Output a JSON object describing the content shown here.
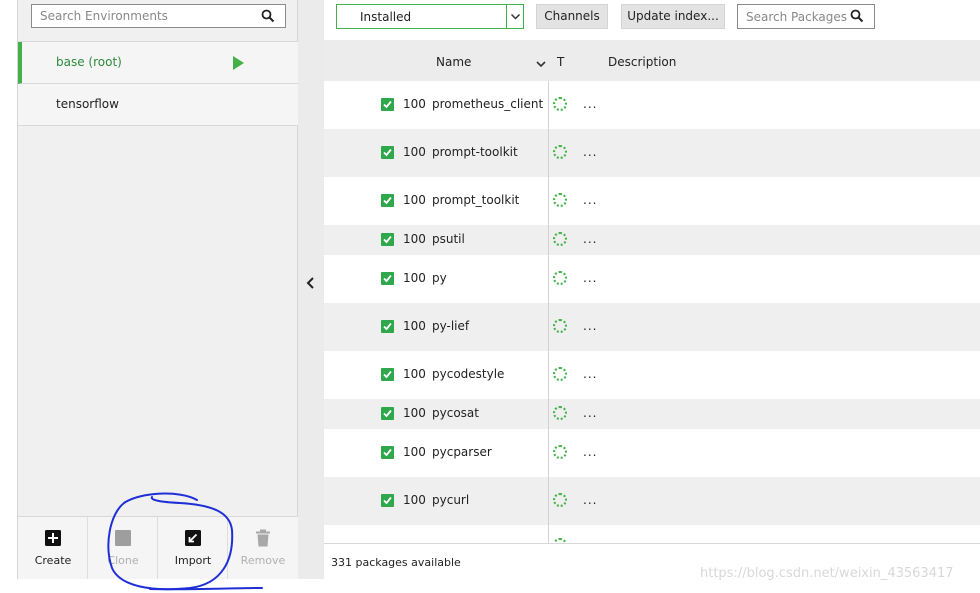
{
  "environments": {
    "search_placeholder": "Search Environments",
    "items": [
      {
        "label": "base (root)",
        "active": true
      },
      {
        "label": "tensorflow",
        "active": false
      }
    ],
    "actions": {
      "create": "Create",
      "clone": "Clone",
      "import": "Import",
      "remove": "Remove"
    }
  },
  "toolbar": {
    "filter_value": "Installed",
    "channels_label": "Channels",
    "update_label": "Update index...",
    "search_placeholder": "Search Packages"
  },
  "table": {
    "headers": {
      "name": "Name",
      "type": "T",
      "description": "Description"
    },
    "rows": [
      {
        "pct": "100",
        "name": "prometheus_client",
        "desc": "..."
      },
      {
        "pct": "100",
        "name": "prompt-toolkit",
        "desc": "..."
      },
      {
        "pct": "100",
        "name": "prompt_toolkit",
        "desc": "..."
      },
      {
        "pct": "100",
        "name": "psutil",
        "desc": "..."
      },
      {
        "pct": "100",
        "name": "py",
        "desc": "..."
      },
      {
        "pct": "100",
        "name": "py-lief",
        "desc": "..."
      },
      {
        "pct": "100",
        "name": "pycodestyle",
        "desc": "..."
      },
      {
        "pct": "100",
        "name": "pycosat",
        "desc": "..."
      },
      {
        "pct": "100",
        "name": "pycparser",
        "desc": "..."
      },
      {
        "pct": "100",
        "name": "pycurl",
        "desc": "..."
      }
    ]
  },
  "status": {
    "text": "331 packages available"
  },
  "watermark": "https://blog.csdn.net/weixin_43563417",
  "colors": {
    "accent": "#43b049",
    "checkbox": "#2ea84a",
    "annotation": "#1f2fd6"
  }
}
